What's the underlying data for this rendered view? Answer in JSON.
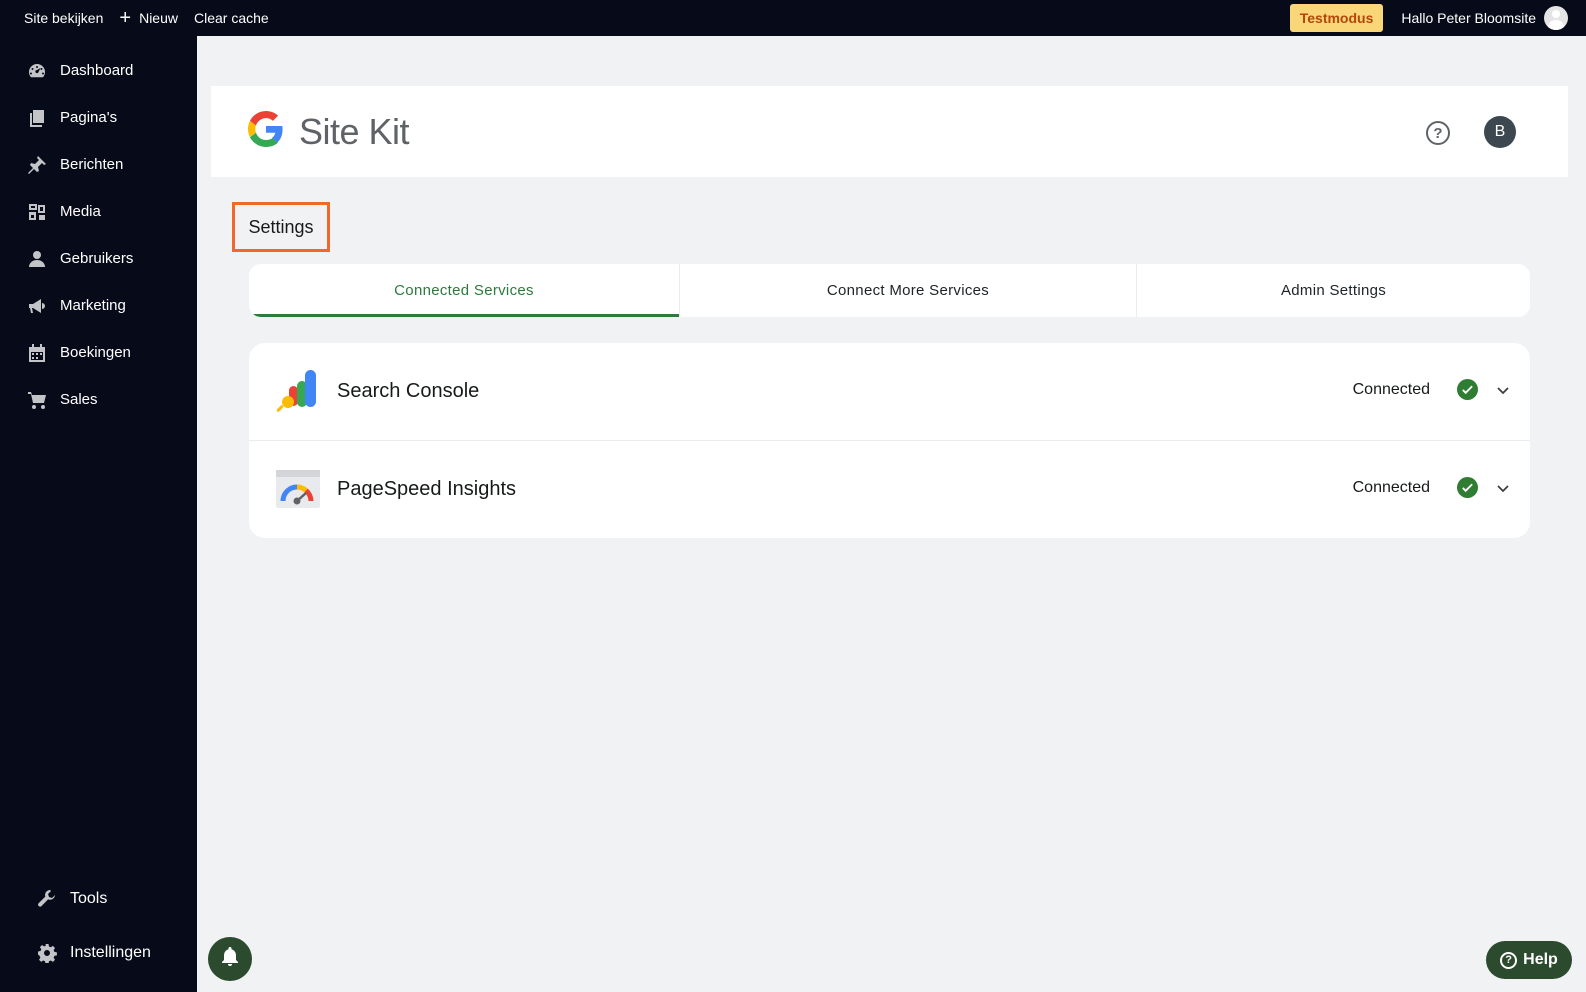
{
  "adminbar": {
    "view_site": "Site bekijken",
    "new": "Nieuw",
    "clear_cache": "Clear cache",
    "test_mode": "Testmodus",
    "greeting": "Hallo Peter Bloomsite"
  },
  "sidebar": {
    "items": [
      {
        "label": "Dashboard",
        "icon": "dashboard-icon"
      },
      {
        "label": "Pagina's",
        "icon": "pages-icon"
      },
      {
        "label": "Berichten",
        "icon": "pin-icon"
      },
      {
        "label": "Media",
        "icon": "media-icon"
      },
      {
        "label": "Gebruikers",
        "icon": "user-icon"
      },
      {
        "label": "Marketing",
        "icon": "megaphone-icon"
      },
      {
        "label": "Boekingen",
        "icon": "calendar-icon"
      },
      {
        "label": "Sales",
        "icon": "cart-icon"
      }
    ],
    "bottom_items": [
      {
        "label": "Tools",
        "icon": "wrench-icon"
      },
      {
        "label": "Instellingen",
        "icon": "gear-icon"
      }
    ]
  },
  "header": {
    "title": "Site Kit",
    "help_symbol": "?",
    "user_initial": "B"
  },
  "page": {
    "heading": "Settings"
  },
  "tabs": [
    {
      "label": "Connected Services",
      "active": true
    },
    {
      "label": "Connect More Services",
      "active": false
    },
    {
      "label": "Admin Settings",
      "active": false
    }
  ],
  "services": [
    {
      "name": "Search Console",
      "status": "Connected",
      "icon": "search-console-icon"
    },
    {
      "name": "PageSpeed Insights",
      "status": "Connected",
      "icon": "pagespeed-icon"
    }
  ],
  "help_button": {
    "label": "Help",
    "symbol": "?"
  },
  "colors": {
    "accent_green": "#2d7a3d",
    "status_check": "#2e7d32",
    "highlight_box": "#f2672a",
    "admin_bg": "#070b19",
    "testmode_bg": "#f9d779"
  }
}
